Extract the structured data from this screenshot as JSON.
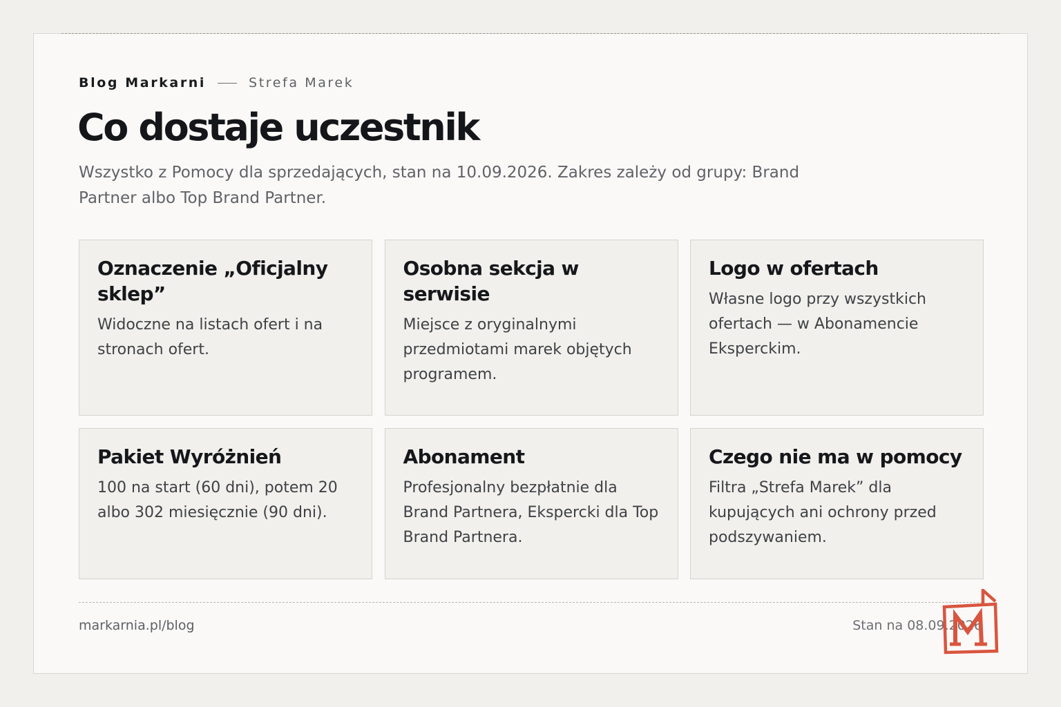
{
  "header": {
    "brand": "Blog Markarni",
    "section": "Strefa Marek",
    "title": "Co dostaje uczestnik",
    "lead": "Wszystko z Pomocy dla sprzedających, stan na 10.09.2026. Zakres zależy od grupy: Brand Partner albo Top Brand Partner."
  },
  "tiles": [
    {
      "title": "Oznaczenie „Oficjalny sklep”",
      "text": "Widoczne na listach ofert i na stronach ofert."
    },
    {
      "title": "Osobna sekcja w serwisie",
      "text": "Miejsce z oryginalnymi przedmiotami marek objętych programem."
    },
    {
      "title": "Logo w ofertach",
      "text": "Własne logo przy wszystkich ofertach — w Abonamencie Eksperckim."
    },
    {
      "title": "Pakiet Wyróżnień",
      "text": "100 na start (60 dni), potem 20 albo 302 miesięcznie (90 dni)."
    },
    {
      "title": "Abonament",
      "text": "Profesjonalny bezpłatnie dla Brand Partnera, Ekspercki dla Top Brand Partnera."
    },
    {
      "title": "Czego nie ma w pomocy",
      "text": "Filtra „Strefa Marek” dla kupujących ani ochrony przed podszywaniem."
    }
  ],
  "footer": {
    "url": "markarnia.pl/blog",
    "date": "Stan na 08.09.2026"
  },
  "logo": {
    "icon": "markarnia-m-logo-icon",
    "color": "#d9553f"
  }
}
